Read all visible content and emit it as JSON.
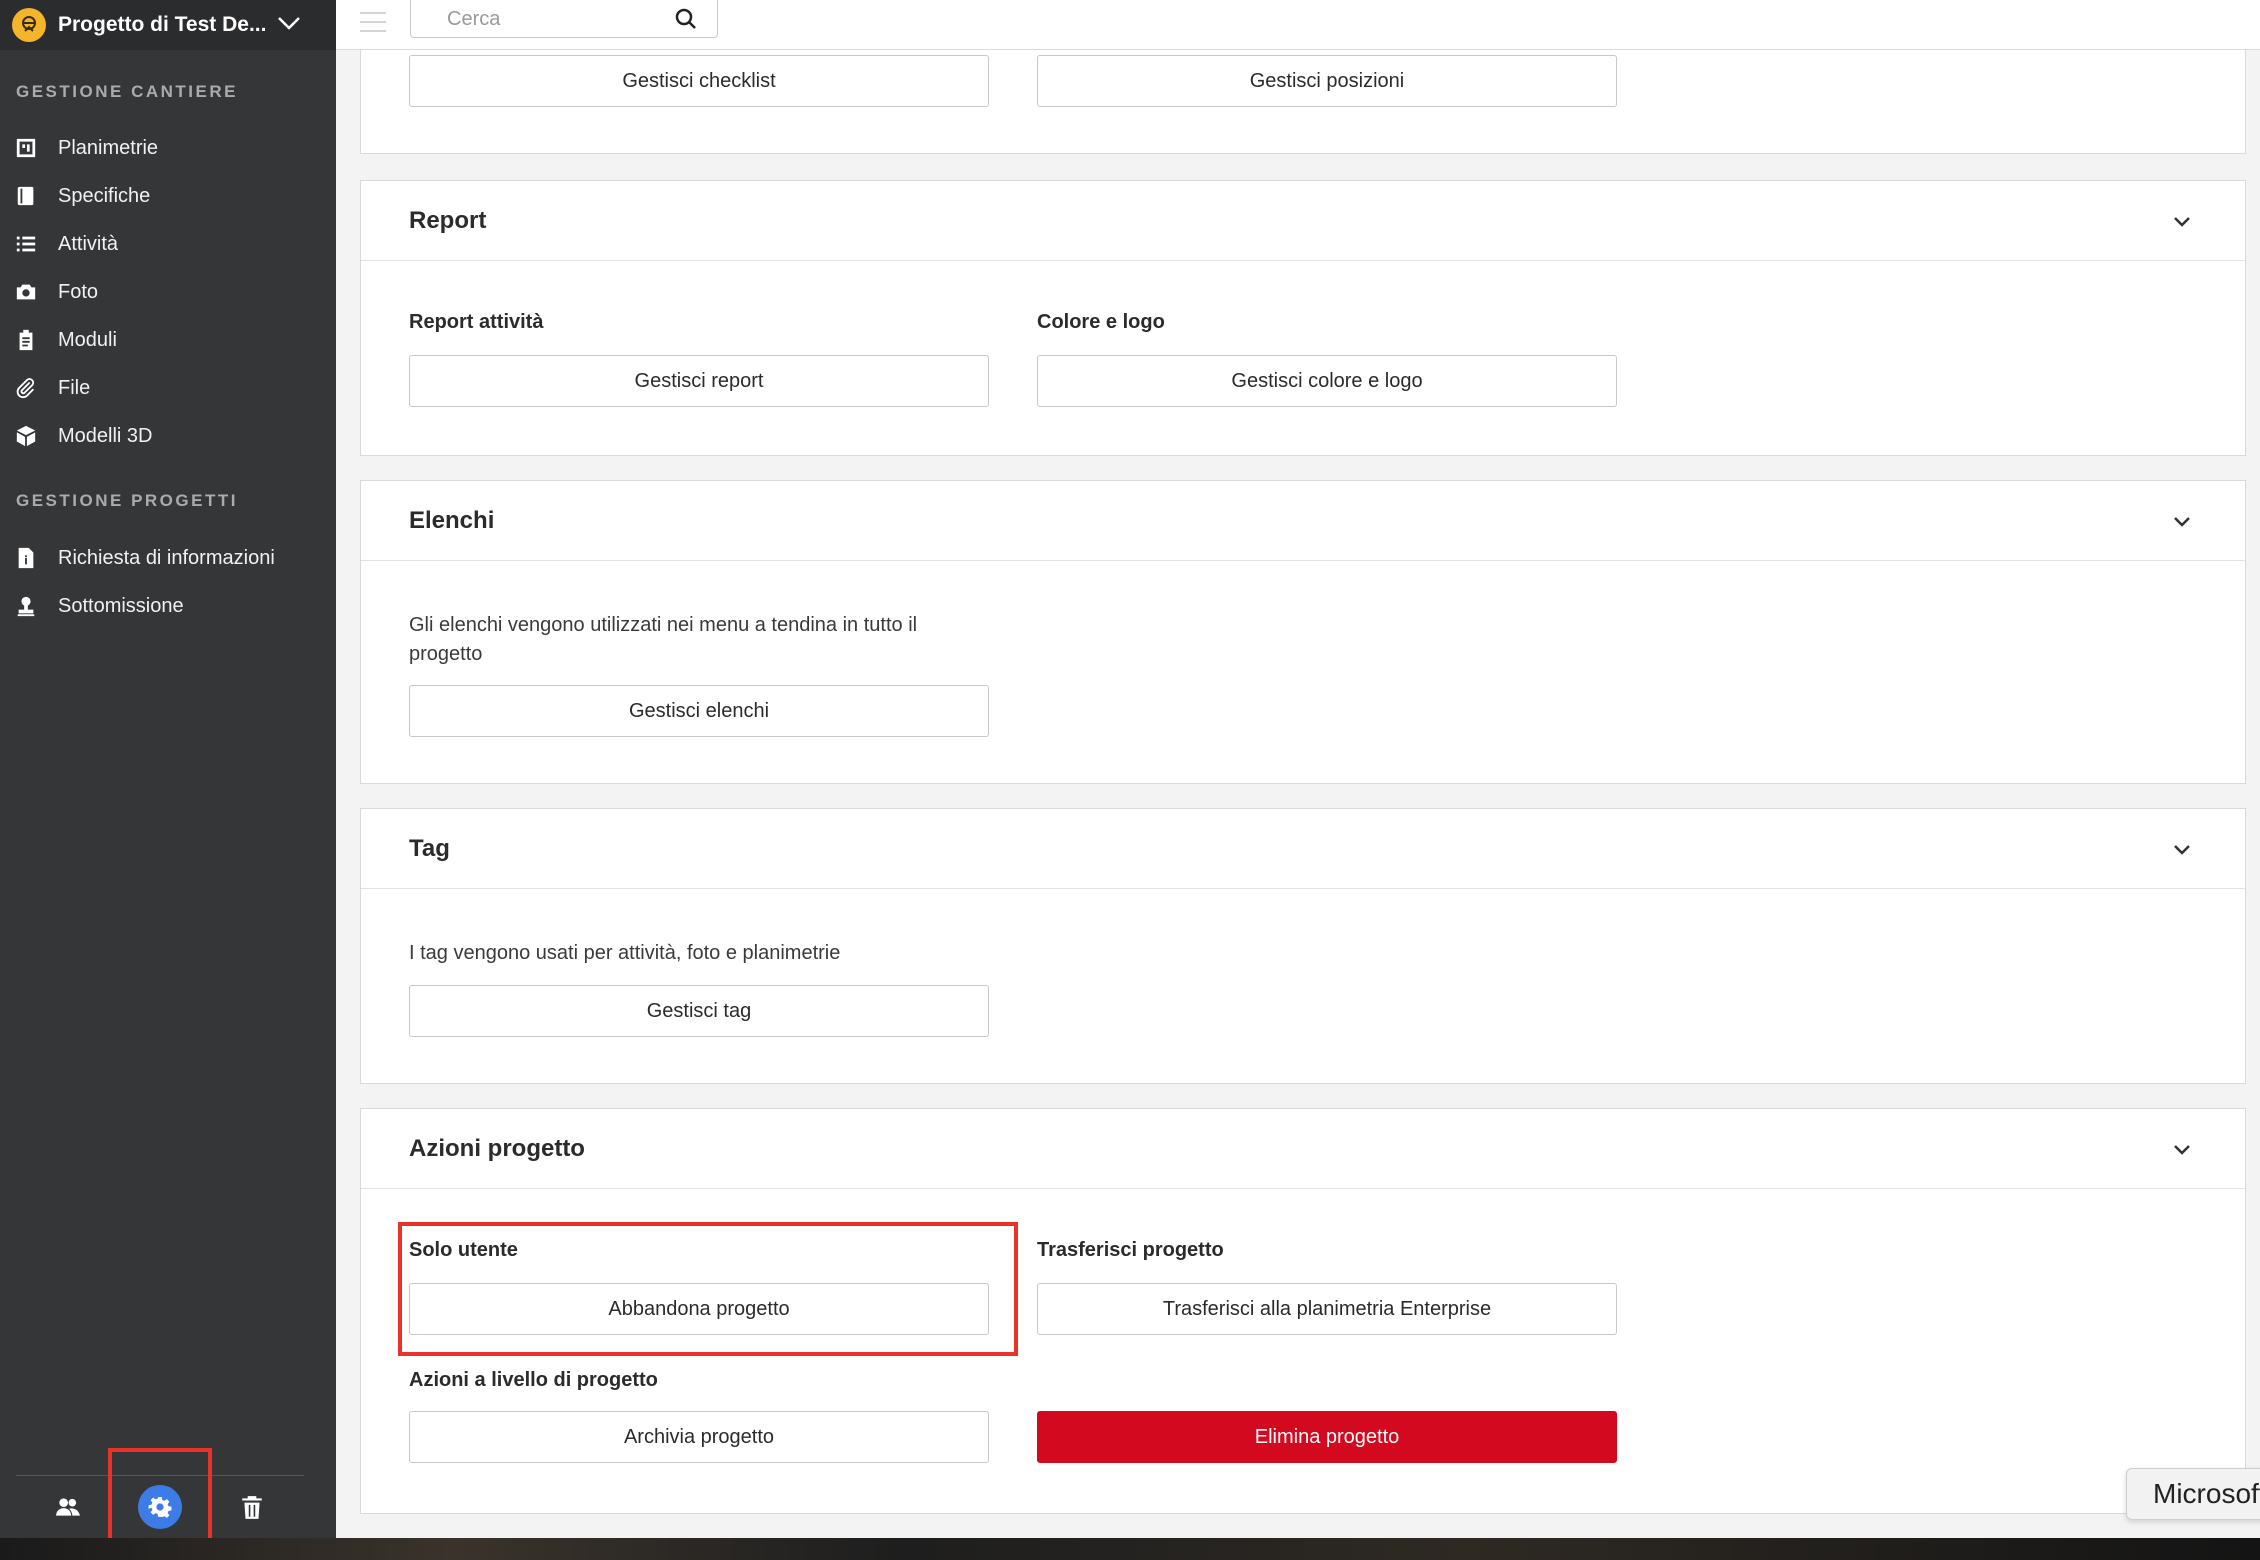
{
  "sidebar": {
    "project_title": "Progetto di Test De...",
    "section_site": "GESTIONE CANTIERE",
    "site_items": [
      {
        "label": "Planimetrie",
        "icon": "floorplan-icon"
      },
      {
        "label": "Specifiche",
        "icon": "book-icon"
      },
      {
        "label": "Attività",
        "icon": "list-icon"
      },
      {
        "label": "Foto",
        "icon": "camera-icon"
      },
      {
        "label": "Moduli",
        "icon": "clipboard-icon"
      },
      {
        "label": "File",
        "icon": "paperclip-icon"
      },
      {
        "label": "Modelli 3D",
        "icon": "cube-icon"
      }
    ],
    "section_projects": "GESTIONE PROGETTI",
    "project_items": [
      {
        "label": "Richiesta di informazioni",
        "icon": "info-document-icon"
      },
      {
        "label": "Sottomissione",
        "icon": "stamp-icon"
      }
    ],
    "accent_color": "#3d7be6"
  },
  "search": {
    "placeholder": "Cerca"
  },
  "cards": {
    "top": {
      "checklist_button": "Gestisci checklist",
      "positions_button": "Gestisci posizioni"
    },
    "report": {
      "title": "Report",
      "activity_label": "Report attività",
      "activity_button": "Gestisci report",
      "color_label": "Colore e logo",
      "color_button": "Gestisci colore e logo"
    },
    "lists": {
      "title": "Elenchi",
      "description": "Gli elenchi vengono utilizzati nei menu a tendina in tutto il progetto",
      "button": "Gestisci elenchi"
    },
    "tags": {
      "title": "Tag",
      "description": "I tag vengono usati per attività, foto e planimetrie",
      "button": "Gestisci tag"
    },
    "actions": {
      "title": "Azioni progetto",
      "user_label": "Solo utente",
      "leave_button": "Abbandona progetto",
      "transfer_label": "Trasferisci progetto",
      "transfer_button": "Trasferisci alla planimetria Enterprise",
      "project_label": "Azioni a livello di progetto",
      "archive_button": "Archivia progetto",
      "delete_button": "Elimina progetto",
      "danger_color": "#d2091f"
    }
  },
  "toast": {
    "text": "Microsoft"
  },
  "highlight_color": "#e8322a"
}
